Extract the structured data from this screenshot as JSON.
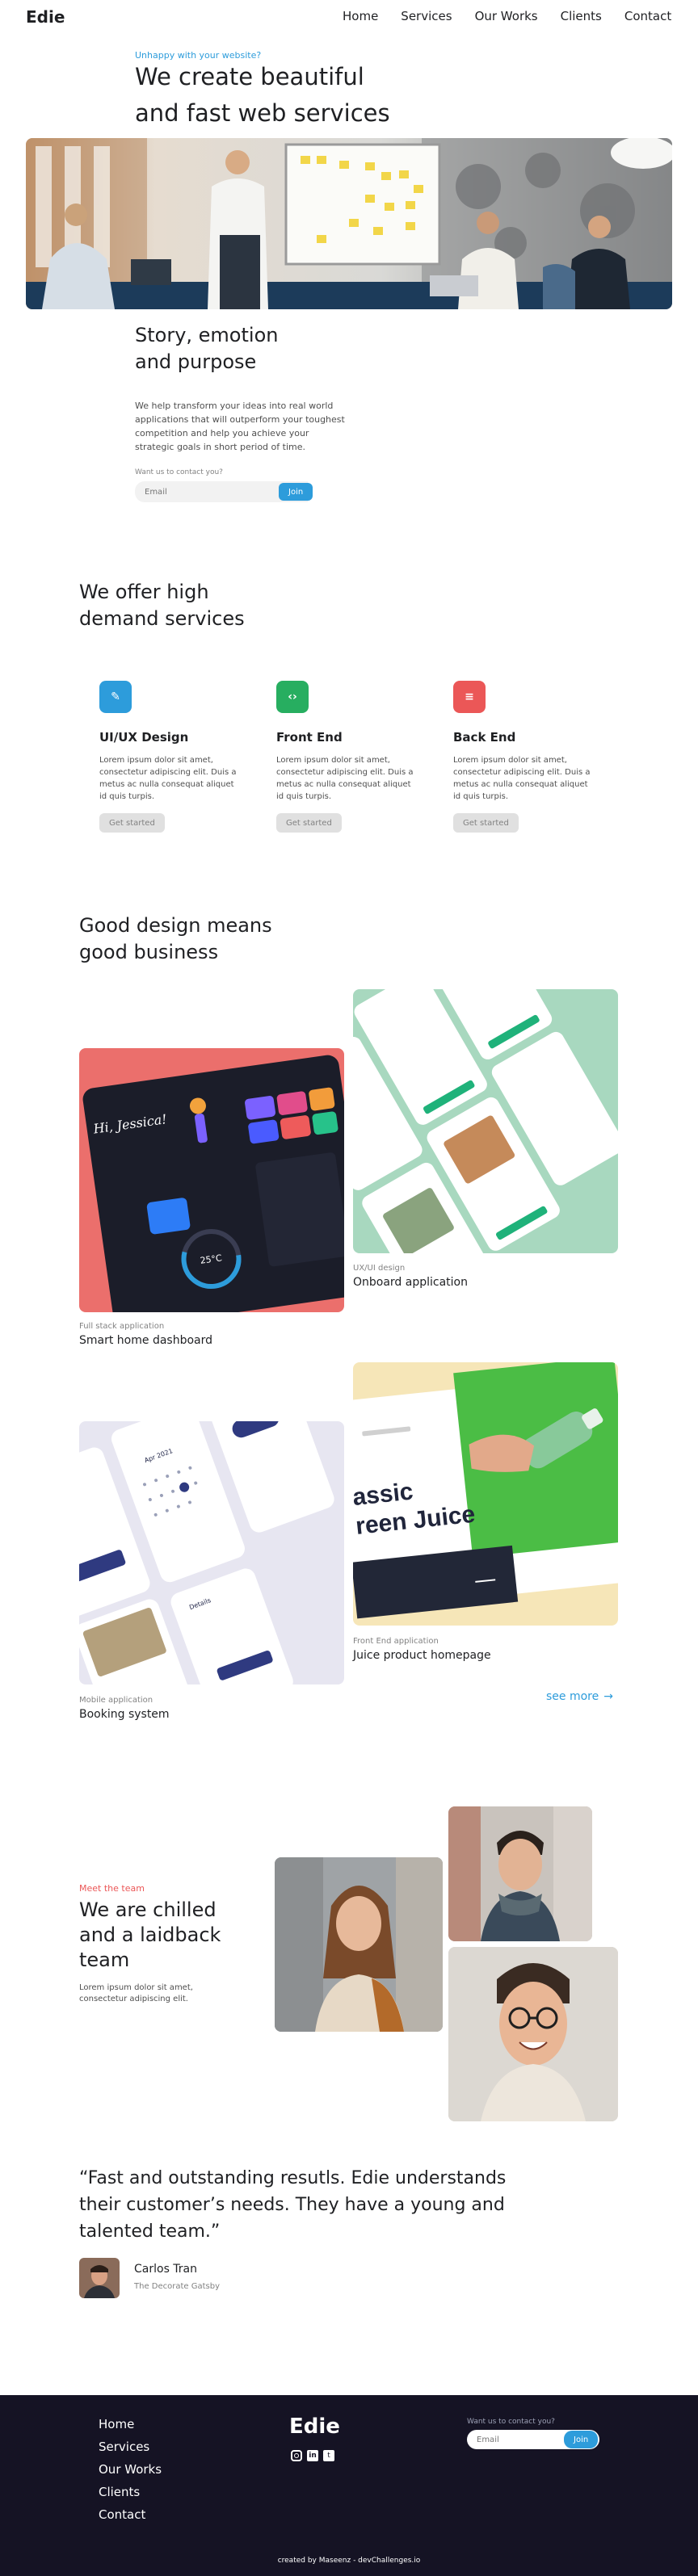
{
  "brand": "Edie",
  "nav": [
    "Home",
    "Services",
    "Our Works",
    "Clients",
    "Contact"
  ],
  "hero": {
    "eyebrow": "Unhappy with your website?",
    "title_line1": "We create beautiful",
    "title_line2": "and fast web services"
  },
  "story": {
    "title_line1": "Story, emotion",
    "title_line2": "and purpose",
    "text_line1": "We help transform your ideas into real world",
    "text_line2": "applications that will outperform your toughest",
    "text_line3": "competition and help you achieve your",
    "text_line4": "strategic goals in short period of time.",
    "contact_label": "Want us to contact you?",
    "email_placeholder": "Email",
    "join_label": "Join"
  },
  "services": {
    "title_line1": "We offer high",
    "title_line2": "demand services",
    "items": [
      {
        "title": "UI/UX Design",
        "icon": "pencil-icon",
        "color": "#2d9cdb",
        "glyph": "✎",
        "text": [
          "Lorem ipsum dolor sit amet,",
          "consectetur adipiscing elit. Duis a",
          "metus ac nulla consequat aliquet",
          "id quis turpis."
        ],
        "button": "Get started"
      },
      {
        "title": "Front End",
        "icon": "code-icon",
        "color": "#27ae60",
        "glyph": "‹›",
        "text": [
          "Lorem ipsum dolor sit amet,",
          "consectetur adipiscing elit. Duis a",
          "metus ac nulla consequat aliquet",
          "id quis turpis."
        ],
        "button": "Get started"
      },
      {
        "title": "Back End",
        "icon": "list-icon",
        "color": "#eb5757",
        "glyph": "≡",
        "text": [
          "Lorem ipsum dolor sit amet,",
          "consectetur adipiscing elit. Duis a",
          "metus ac nulla consequat aliquet",
          "id quis turpis."
        ],
        "button": "Get started"
      }
    ]
  },
  "works": {
    "title_line1": "Good design means",
    "title_line2": "good business",
    "items": [
      {
        "category": "Full stack application",
        "title": "Smart home dashboard"
      },
      {
        "category": "UX/UI design",
        "title": "Onboard application"
      },
      {
        "category": "Mobile application",
        "title": "Booking system"
      },
      {
        "category": "Front End application",
        "title": "Juice product homepage"
      }
    ],
    "see_more": "see more",
    "dashboard_greeting": "Hi, Jessica!",
    "dashboard_temp": "25°C",
    "juice_headline_1": "assic",
    "juice_headline_2": "reen Juice",
    "booking_date": "Apr 2021",
    "booking_header": "Details"
  },
  "team": {
    "eyebrow": "Meet the team",
    "title_line1": "We are chilled",
    "title_line2": "and a laidback",
    "title_line3": "team",
    "text_line1": "Lorem ipsum dolor sit amet,",
    "text_line2": "consectetur adipiscing elit."
  },
  "testimonial": {
    "quote_line1": "“Fast and outstanding resutls. Edie understands",
    "quote_line2": "their customer’s needs. They have a young and",
    "quote_line3": "talented team.”",
    "name": "Carlos Tran",
    "company": "The Decorate Gatsby"
  },
  "footer": {
    "links": [
      "Home",
      "Services",
      "Our Works",
      "Clients",
      "Contact"
    ],
    "brand": "Edie",
    "contact_label": "Want us to contact you?",
    "email_placeholder": "Email",
    "join_label": "Join",
    "credit": "created by Maseenz - devChallenges.io"
  },
  "colors": {
    "accent": "#2d9cdb",
    "green": "#27ae60",
    "red": "#eb5757",
    "dark": "#151324"
  }
}
